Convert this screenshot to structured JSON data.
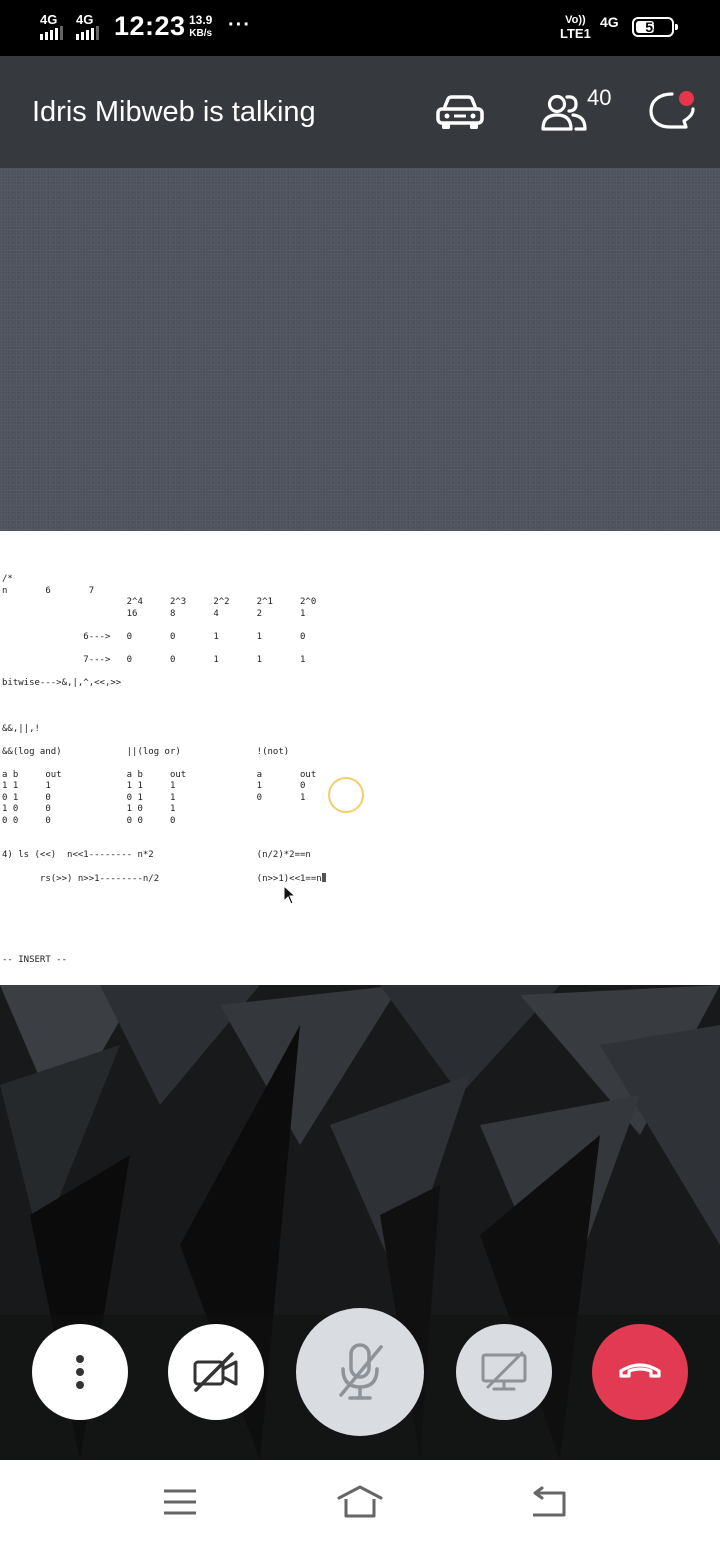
{
  "status_bar": {
    "network_1": "4G",
    "network_2": "4G",
    "time": "12:23",
    "speed_value": "13.9",
    "speed_unit": "KB/s",
    "more": "···",
    "volte_top": "Vo))",
    "volte_bottom": "LTE1",
    "network_3": "4G",
    "battery": "53",
    "battery_level": 0.53
  },
  "call": {
    "title": "Idris Mibweb is talking",
    "participants_count": "40",
    "chat_has_unread": true
  },
  "shared_screen": {
    "lines": [
      "/*",
      "n       6       7",
      "                       2^4     2^3     2^2     2^1     2^0",
      "                       16      8       4       2       1",
      "",
      "               6--->   0       0       1       1       0",
      "",
      "               7--->   0       0       1       1       1",
      "",
      "bitwise--->&,|,^,<<,>>",
      "",
      "",
      "",
      "&&,||,!",
      "",
      "&&(log and)            ||(log or)              !(not)",
      "",
      "a b     out            a b     out             a       out",
      "1 1     1              1 1     1               1       0",
      "0 1     0              0 1     1               0       1",
      "1 0     0              1 0     1",
      "0 0     0              0 0     0",
      "",
      "",
      "4) ls (<<)  n<<1-------- n*2                   (n/2)*2==n",
      "",
      "       rs(>>) n>>1--------n/2                  (n>>1)<<1==n",
      "",
      "",
      "",
      "",
      "",
      "",
      "-- INSERT --"
    ]
  },
  "controls": {
    "more_icon": "more-vertical-icon",
    "camera_icon": "video-off-icon",
    "mic_icon": "mic-off-icon",
    "share_icon": "screen-share-off-icon",
    "hangup_icon": "hangup-icon",
    "hangup_color": "#e23a52"
  },
  "nav": {
    "menu_icon": "menu-icon",
    "home_icon": "home-icon",
    "back_icon": "back-icon"
  }
}
